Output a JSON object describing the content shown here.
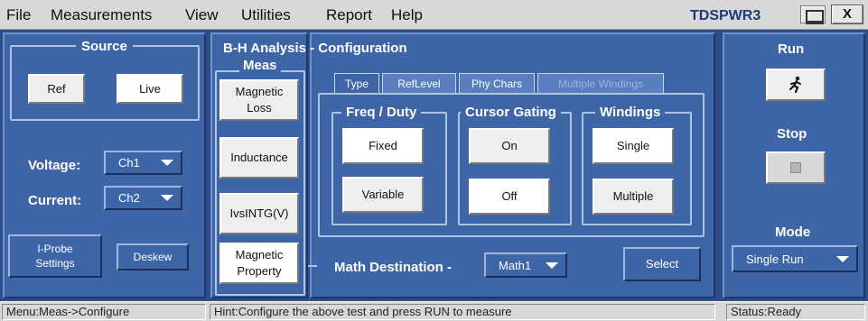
{
  "menubar": {
    "items": [
      "File",
      "Measurements",
      "View",
      "Utilities",
      "Report",
      "Help"
    ],
    "brand": "TDSPWR3",
    "close": "X"
  },
  "source": {
    "title": "Source",
    "ref_label": "Ref",
    "live_label": "Live",
    "voltage_label": "Voltage:",
    "voltage_value": "Ch1",
    "current_label": "Current:",
    "current_value": "Ch2",
    "iprobe_line1": "I-Probe",
    "iprobe_line2": "Settings",
    "deskew_label": "Deskew"
  },
  "meas": {
    "header": "B-H Analysis - Configuration",
    "title": "Meas",
    "items": [
      {
        "line1": "Magnetic",
        "line2": "Loss"
      },
      {
        "line1": "Inductance",
        "line2": ""
      },
      {
        "line1": "IvsINTG(V)",
        "line2": ""
      },
      {
        "line1": "Magnetic",
        "line2": "Property"
      }
    ]
  },
  "tabs": [
    "Type",
    "RefLevel",
    "Phy Chars",
    "Multiple Windings"
  ],
  "config": {
    "freq_title": "Freq / Duty",
    "fixed_label": "Fixed",
    "variable_label": "Variable",
    "cursor_title": "Cursor Gating",
    "on_label": "On",
    "off_label": "Off",
    "windings_title": "Windings",
    "single_label": "Single",
    "multiple_label": "Multiple",
    "math_dest_label": "Math Destination -",
    "math_dest_value": "Math1",
    "select_label": "Select"
  },
  "control": {
    "run_label": "Run",
    "stop_label": "Stop",
    "mode_label": "Mode",
    "mode_value": "Single Run"
  },
  "status": {
    "menu": "Menu:Meas->Configure",
    "hint": "Hint:Configure the above test and press RUN to measure",
    "state": "Status:Ready"
  },
  "colors": {
    "panel": "#3e65a6",
    "background": "#2c4e86",
    "brand": "#1e3d78"
  }
}
